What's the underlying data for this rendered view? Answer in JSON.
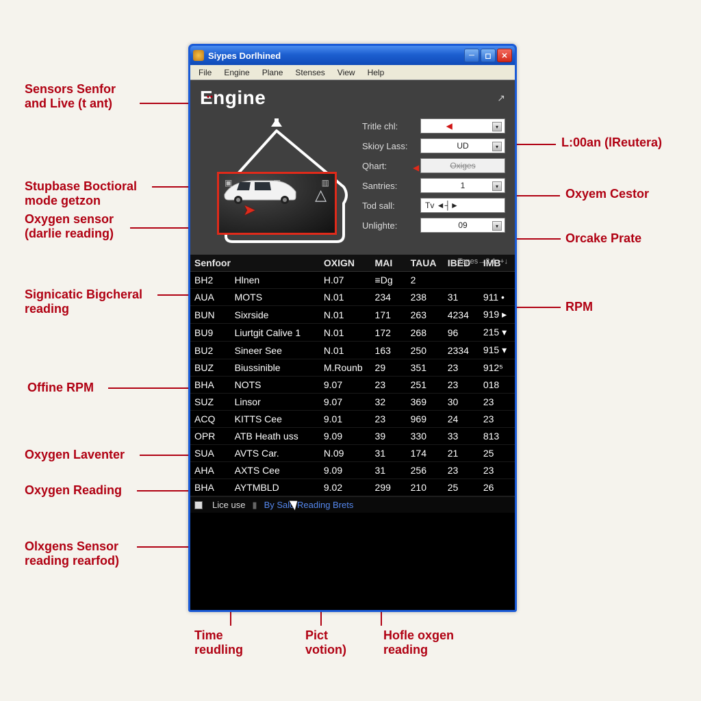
{
  "window": {
    "title": "Siypes Dorlhined",
    "menus": [
      "File",
      "Engine",
      "Plane",
      "Stenses",
      "View",
      "Help"
    ]
  },
  "heading": "Engine",
  "fields": {
    "f1": {
      "label": "Tritle chl:",
      "value": ""
    },
    "f2": {
      "label": "Skioy Lass:",
      "value": "UD"
    },
    "f3": {
      "label": "Qhart:",
      "value": "Oxiges"
    },
    "f4": {
      "label": "Santries:",
      "value": "1"
    },
    "f5": {
      "label": "Tod sall:",
      "value": "Tv ◄┤►"
    },
    "f6": {
      "label": "Unlighte:",
      "value": "09"
    }
  },
  "columns": [
    "Senfoor",
    "OXIGN",
    "MAI",
    "TAUA",
    "IBED",
    "IMB"
  ],
  "header_extra": "←Tapes→2 1↓+↓",
  "rows": [
    {
      "code": "BH2",
      "name": "Hlnen",
      "ox": "H.07",
      "mai": "≡Dg",
      "taua": "2",
      "ibed": "",
      "imb": ""
    },
    {
      "code": "AUA",
      "name": "MOTS",
      "ox": "N.01",
      "mai": "234",
      "taua": "238",
      "ibed": "31",
      "imb": "911 •"
    },
    {
      "code": "BUN",
      "name": "Sixrside",
      "ox": "N.01",
      "mai": "171",
      "taua": "263",
      "ibed": "4234",
      "imb": "919 ▸"
    },
    {
      "code": "BU9",
      "name": "Liurtgit Calive 1",
      "ox": "N.01",
      "mai": "172",
      "taua": "268",
      "ibed": "96",
      "imb": "215 ▾"
    },
    {
      "code": "BU2",
      "name": "Sineer See",
      "ox": "N.01",
      "mai": "163",
      "taua": "250",
      "ibed": "2334",
      "imb": "915 ▾"
    },
    {
      "code": "BUZ",
      "name": "Biussinible",
      "ox": "M.Rounb",
      "mai": "29",
      "taua": "351",
      "ibed": "23",
      "imb": "912⁵"
    },
    {
      "code": "BHA",
      "name": "NOTS",
      "ox": "9.07",
      "mai": "23",
      "taua": "251",
      "ibed": "23",
      "imb": "018"
    },
    {
      "code": "SUZ",
      "name": "Linsor",
      "ox": "9.07",
      "mai": "32",
      "taua": "369",
      "ibed": "30",
      "imb": "23"
    },
    {
      "code": "ACQ",
      "name": "KITTS Cee",
      "ox": "9.01",
      "mai": "23",
      "taua": "969",
      "ibed": "24",
      "imb": "23"
    },
    {
      "code": "OPR",
      "name": "ATB Heath uss",
      "ox": "9.09",
      "mai": "39",
      "taua": "330",
      "ibed": "33",
      "imb": "813"
    },
    {
      "code": "SUA",
      "name": "AVTS Car.",
      "ox": "N.09",
      "mai": "31",
      "taua": "174",
      "ibed": "21",
      "imb": "25"
    },
    {
      "code": "AHA",
      "name": "AXTS Cee",
      "ox": "9.09",
      "mai": "31",
      "taua": "256",
      "ibed": "23",
      "imb": "23"
    },
    {
      "code": "BHA",
      "name": "AYTMBLD",
      "ox": "9.02",
      "mai": "299",
      "taua": "210",
      "ibed": "25",
      "imb": "26"
    }
  ],
  "status": {
    "lice": "Lice use",
    "link": "By Sald Reading Brets"
  },
  "callouts": {
    "left1": "Sensors Senfor\nand Live (t ant)",
    "left2": "Stupbase Boctioral\nmode getzon",
    "left3": "Oxygen sensor\n(darlie reading)",
    "left4": "Signicatic Bigcheral\nreading",
    "left5": "Offine RPM",
    "left6": "Oxygen Laventer",
    "left7": "Oxygen Reading",
    "left8": "Olxgens Sensor\nreading rearfod)",
    "right1": "L:00an (lReutera)",
    "right2": "Oxyem Cestor",
    "right3": "Orcake Prate",
    "right4": "RPM",
    "bottom1": "Time\nreudling",
    "bottom2": "Pict\nvotion)",
    "bottom3": "Hofle oxgen\nreading"
  }
}
